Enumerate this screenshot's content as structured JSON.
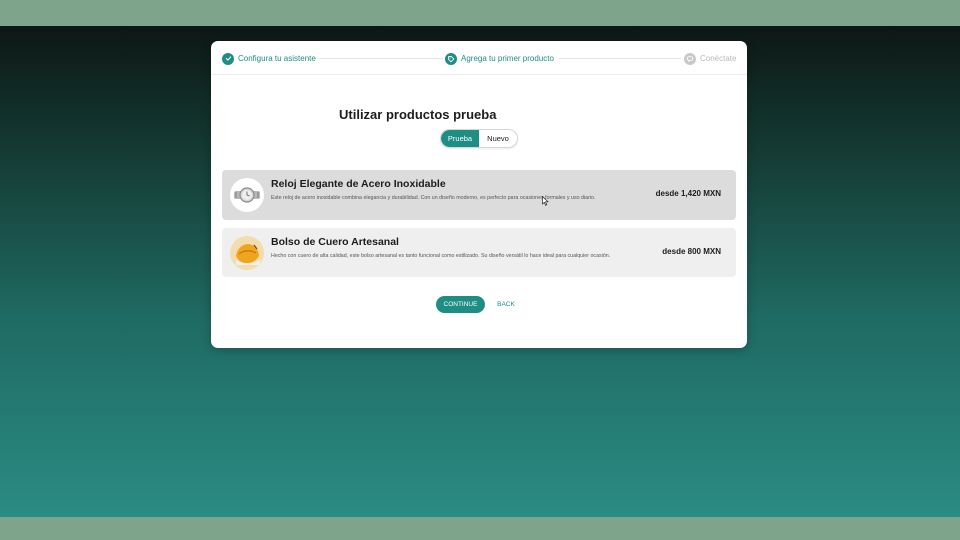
{
  "stepper": {
    "steps": [
      {
        "label": "Configura tu asistente",
        "state": "done"
      },
      {
        "label": "Agrega tu primer producto",
        "state": "current"
      },
      {
        "label": "Conéctate",
        "state": "upcoming"
      }
    ]
  },
  "main": {
    "title": "Utilizar productos prueba",
    "toggle": {
      "options": [
        "Prueba",
        "Nuevo"
      ],
      "selected": "Prueba"
    },
    "products": [
      {
        "name": "Reloj Elegante de Acero Inoxidable",
        "description": "Este reloj de acero inoxidable combina elegancia y durabilidad. Con un diseño moderno, es perfecto para ocasiones formales y uso diario.",
        "price": "desde 1,420 MXN",
        "icon": "watch-icon"
      },
      {
        "name": "Bolso de Cuero Artesanal",
        "description": "Hecho con cuero de alta calidad, este bolso artesanal es tanto funcional como estilizado. Su diseño versátil lo hace ideal para cualquier ocasión.",
        "price": "desde 800 MXN",
        "icon": "bag-icon"
      }
    ],
    "continue_label": "CONTINUE",
    "back_label": "BACK"
  },
  "colors": {
    "accent": "#1e8d83",
    "selected_card": "#dcdcdc",
    "card": "#efefef"
  }
}
